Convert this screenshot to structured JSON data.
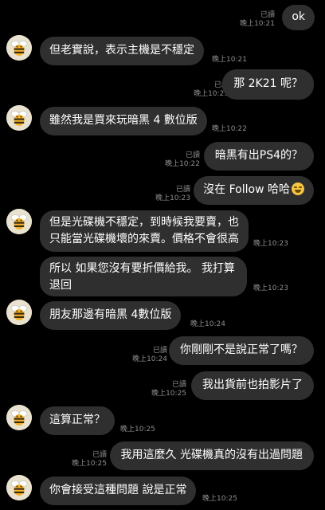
{
  "messages": [
    {
      "text": "ok",
      "read": "已讀",
      "time": "晚上10:21"
    },
    {
      "text": "但老實說，表示主機是不穩定",
      "time": "晚上10:21"
    },
    {
      "text": "那 2K21 呢？",
      "read": "已讀",
      "time": "晚上10:21"
    },
    {
      "text": "雖然我是買來玩暗黑 4 數位版",
      "time": "晚上10:22"
    },
    {
      "text": "暗黑有出PS4的？",
      "read": "已讀",
      "time": "晚上10:22"
    },
    {
      "text": "沒在 Follow 哈哈",
      "read": "已讀",
      "time": "晚上10:23"
    },
    {
      "text": "但是光碟機不穩定，到時候我要賣，也只能當光碟機壞的來賣。價格不會很高",
      "time": "晚上10:23"
    },
    {
      "text": "所以 如果您沒有要折價給我。 我打算退回",
      "time": "晚上10:23"
    },
    {
      "text": "朋友那邊有暗黑 4數位版",
      "time": "晚上10:24"
    },
    {
      "text": "你剛剛不是說正常了嗎？",
      "read": "已讀",
      "time": "晚上10:24"
    },
    {
      "text": "我出貨前也拍影片了",
      "read": "已讀",
      "time": "晚上10:25"
    },
    {
      "text": "這算正常？",
      "time": "晚上10:25"
    },
    {
      "text": "我用這麼久 光碟機真的沒有出過問題",
      "read": "已讀",
      "time": "晚上10:25"
    },
    {
      "text": "你會接受這種問題 說是正常",
      "time": "晚上10:25"
    }
  ],
  "emoji": "grinning-sweat-emoji",
  "colors": {
    "background": "#000000",
    "bubble": "#2f2f2f",
    "meta": "#8e8e8e"
  }
}
